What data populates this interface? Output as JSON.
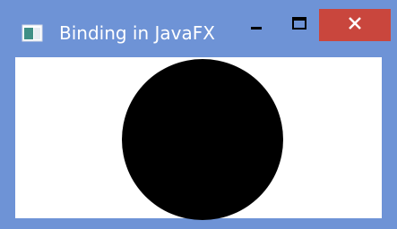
{
  "window": {
    "title": "Binding in JavaFX",
    "titlebar_color": "#6e93d6",
    "close_color": "#c9463d",
    "controls": {
      "minimize_icon": "minimize-icon",
      "maximize_icon": "maximize-icon",
      "close_icon": "close-icon"
    }
  },
  "content": {
    "background": "#ffffff",
    "shape": "circle",
    "shape_fill": "#000000"
  }
}
